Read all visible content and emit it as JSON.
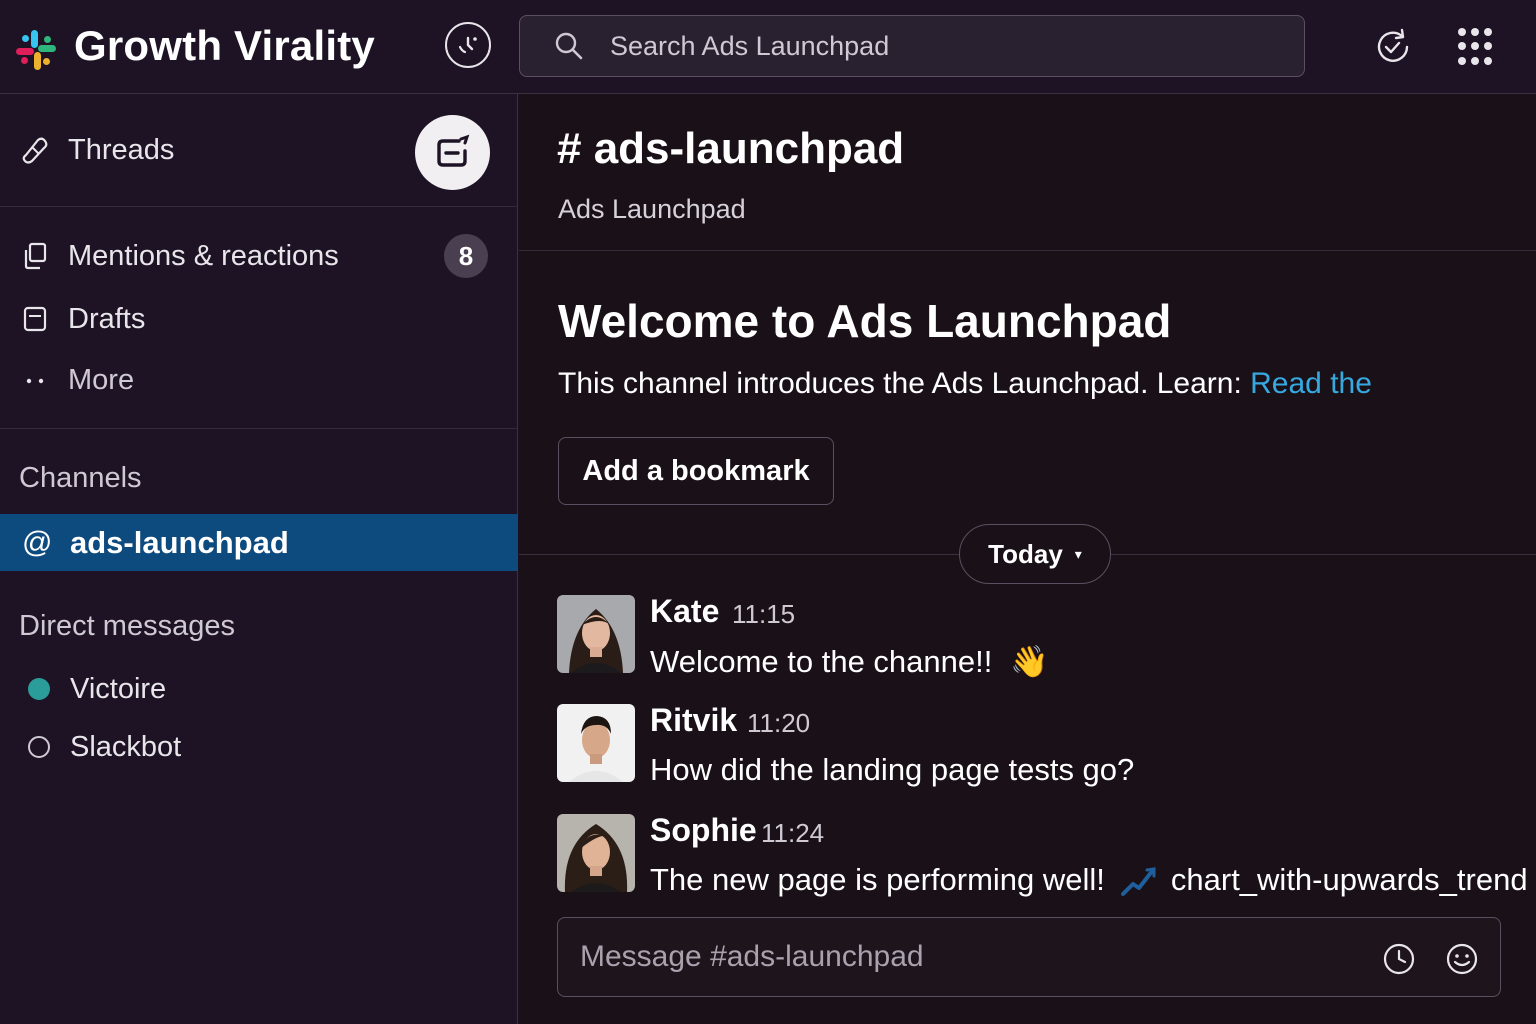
{
  "workspace": {
    "name": "Growth Virality"
  },
  "search": {
    "placeholder": "Search Ads Launchpad"
  },
  "sidebar": {
    "threads_label": "Threads",
    "items": [
      {
        "label": "Mentions & reactions",
        "icon": "mentions-icon",
        "badge": "8"
      },
      {
        "label": "Drafts",
        "icon": "drafts-icon"
      },
      {
        "label": "More",
        "icon": "more-icon"
      }
    ],
    "channels_heading": "Channels",
    "channels": [
      {
        "name": "ads-launchpad",
        "prefix": "@",
        "active": true
      }
    ],
    "dm_heading": "Direct messages",
    "dms": [
      {
        "name": "Victoire",
        "status": "online"
      },
      {
        "name": "Slackbot",
        "status": "offline"
      }
    ]
  },
  "channel": {
    "title": "# ads-launchpad",
    "subtitle": "Ads Launchpad",
    "welcome_title": "Welcome to Ads Launchpad",
    "welcome_desc": "This channel introduces the Ads Launchpad. Learn: ",
    "welcome_link": "Read the",
    "bookmark_label": "Add a bookmark",
    "day_label": "Today",
    "day_caret": "▾"
  },
  "messages": [
    {
      "author": "Kate",
      "time": "11:15",
      "text": "Welcome to the channe!!",
      "emoji": "👋"
    },
    {
      "author": "Ritvik",
      "time": "11:20",
      "text": "How did the landing page tests go?"
    },
    {
      "author": "Sophie",
      "time": "11:24",
      "text": "The new page is performing well!",
      "emoji_text": "chart_with-upwards_trend"
    }
  ],
  "composer": {
    "placeholder": "Message #ads-launchpad"
  },
  "colors": {
    "background": "#1b1120",
    "active_channel": "#0d4a7e",
    "link": "#36a9e1",
    "presence_online": "#2a9d9a"
  }
}
